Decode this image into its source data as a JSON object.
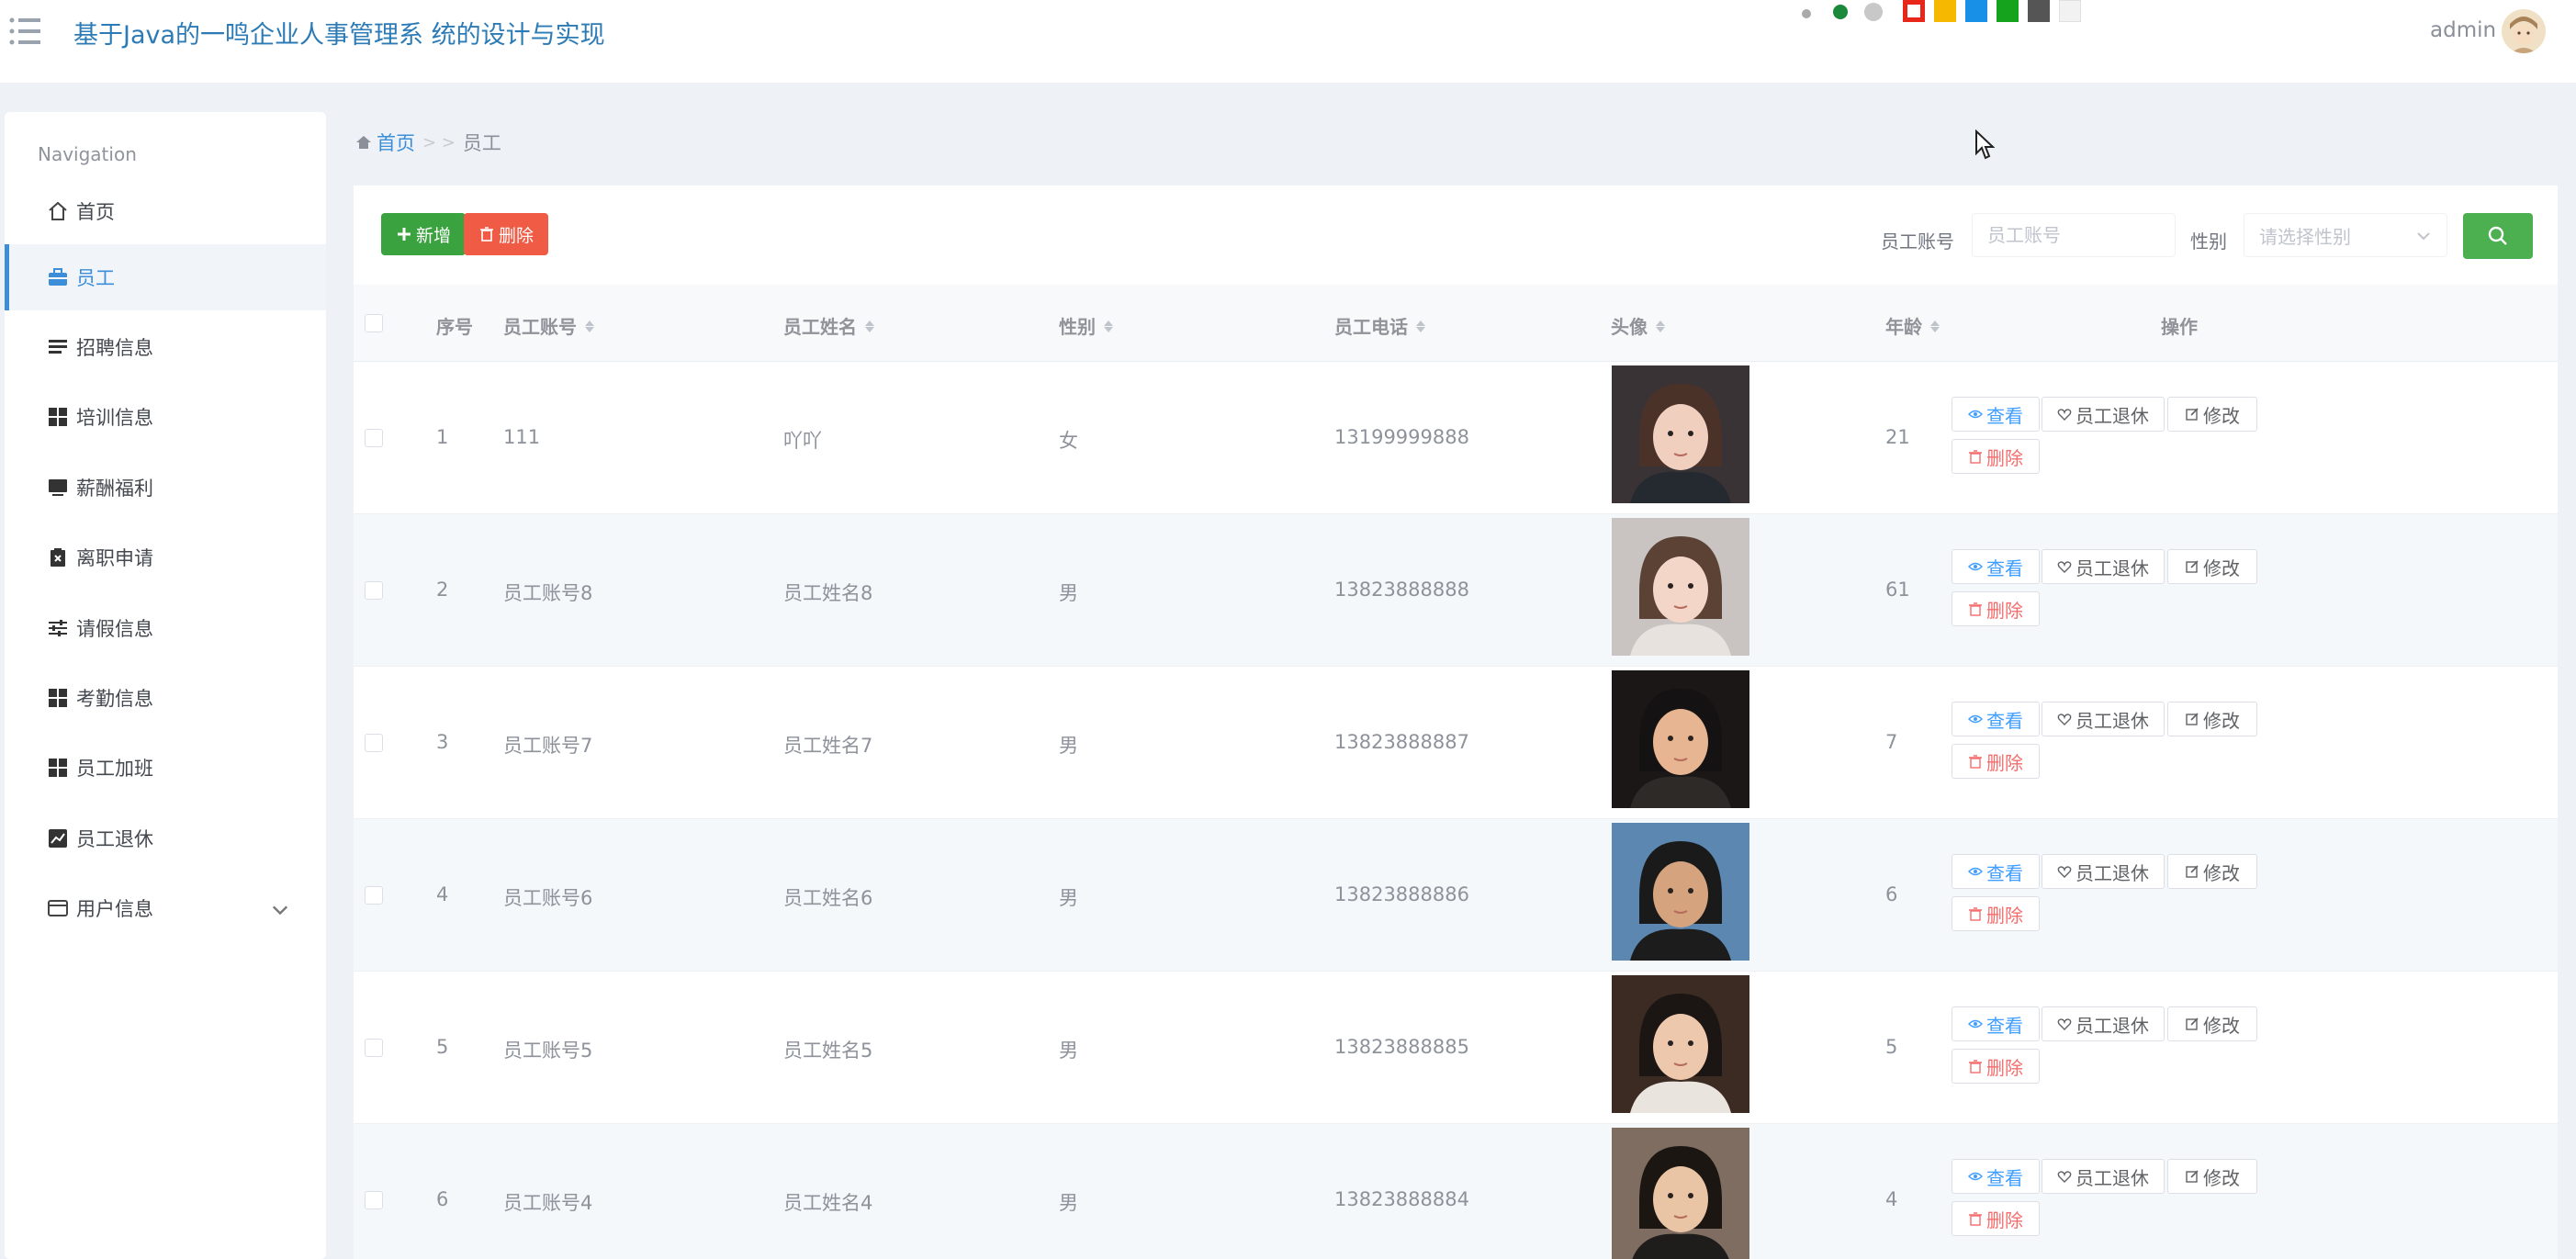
{
  "header": {
    "title": "基于Java的一鸣企业人事管理系 统的设计与实现",
    "user": "admin",
    "theme_colors": [
      "#aaaaaa",
      "#1a8a3a",
      "#c8c8c8",
      "#e8261a",
      "#f6b800",
      "#1890e8",
      "#15a21c",
      "#555555",
      "#f2f2f2"
    ]
  },
  "sidebar": {
    "heading": "Navigation",
    "items": [
      {
        "label": "首页",
        "icon": "home-icon"
      },
      {
        "label": "员工",
        "icon": "briefcase-icon"
      },
      {
        "label": "招聘信息",
        "icon": "list-icon"
      },
      {
        "label": "培训信息",
        "icon": "grid-icon"
      },
      {
        "label": "薪酬福利",
        "icon": "monitor-icon"
      },
      {
        "label": "离职申请",
        "icon": "clipboard-x-icon"
      },
      {
        "label": "请假信息",
        "icon": "sliders-icon"
      },
      {
        "label": "考勤信息",
        "icon": "grid-icon"
      },
      {
        "label": "员工加班",
        "icon": "grid-icon"
      },
      {
        "label": "员工退休",
        "icon": "chart-line-icon"
      },
      {
        "label": "用户信息",
        "icon": "card-icon"
      }
    ]
  },
  "breadcrumb": {
    "home": "首页",
    "separator": "> >",
    "current": "员工"
  },
  "toolbar": {
    "add_label": "新增",
    "delete_label": "删除",
    "filter_account_label": "员工账号",
    "filter_account_placeholder": "员工账号",
    "filter_gender_label": "性别",
    "filter_gender_placeholder": "请选择性别"
  },
  "table": {
    "headers": {
      "index": "序号",
      "account": "员工账号",
      "name": "员工姓名",
      "gender": "性别",
      "phone": "员工电话",
      "avatar": "头像",
      "age": "年龄",
      "actions": "操作"
    },
    "actions": {
      "view": "查看",
      "retire": "员工退休",
      "edit": "修改",
      "delete": "删除"
    },
    "rows": [
      {
        "index": "1",
        "account": "111",
        "name": "吖吖",
        "gender": "女",
        "phone": "13199999888",
        "age": "21"
      },
      {
        "index": "2",
        "account": "员工账号8",
        "name": "员工姓名8",
        "gender": "男",
        "phone": "13823888888",
        "age": "61"
      },
      {
        "index": "3",
        "account": "员工账号7",
        "name": "员工姓名7",
        "gender": "男",
        "phone": "13823888887",
        "age": "7"
      },
      {
        "index": "4",
        "account": "员工账号6",
        "name": "员工姓名6",
        "gender": "男",
        "phone": "13823888886",
        "age": "6"
      },
      {
        "index": "5",
        "account": "员工账号5",
        "name": "员工姓名5",
        "gender": "男",
        "phone": "13823888885",
        "age": "5"
      },
      {
        "index": "6",
        "account": "员工账号4",
        "name": "员工姓名4",
        "gender": "男",
        "phone": "13823888884",
        "age": "4"
      }
    ]
  }
}
